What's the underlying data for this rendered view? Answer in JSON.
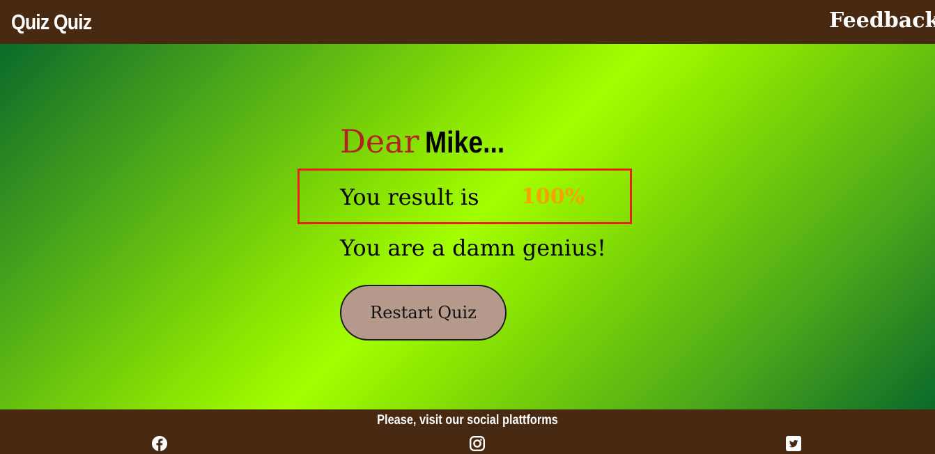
{
  "header": {
    "logo": "Quiz Quiz",
    "feedback_link": "Feedback"
  },
  "result": {
    "greeting_word": "Dear",
    "user_name": "Mike...",
    "label": "You result is",
    "score": "100%",
    "verdict": "You are a damn genius!",
    "restart_button": "Restart Quiz"
  },
  "footer": {
    "text": "Please, visit our social plattforms",
    "social": [
      {
        "icon": "facebook-icon"
      },
      {
        "icon": "instagram-icon"
      },
      {
        "icon": "twitter-icon"
      }
    ]
  },
  "colors": {
    "header_bg": "#482912",
    "dear_red": "#b22222",
    "score_orange": "#f4a300",
    "highlight_border": "#e8211d",
    "button_bg": "#b59a8c"
  }
}
